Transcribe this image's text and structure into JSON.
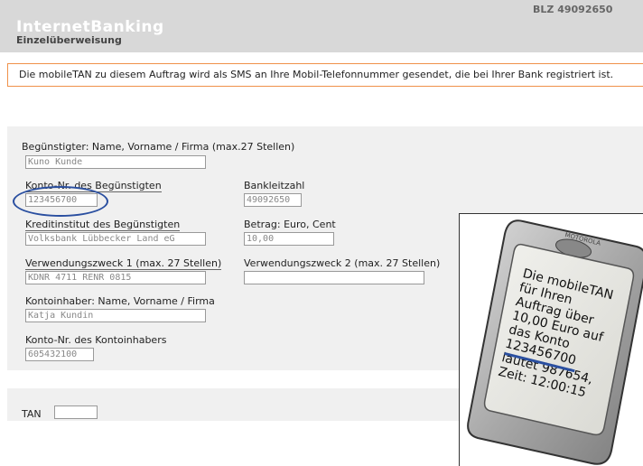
{
  "header": {
    "title": "InternetBanking",
    "subtitle": "Einzelüberweisung",
    "blz": "BLZ 49092650"
  },
  "notice": "Die mobileTAN zu diesem Auftrag wird als SMS an Ihre Mobil-Telefonnummer gesendet, die bei Ihrer Bank registriert ist.",
  "form": {
    "beneficiary_label": "Begünstigter: Name, Vorname / Firma (max.27 Stellen)",
    "beneficiary_value": "Kuno Kunde",
    "account_label": "Konto-Nr. des Begünstigten",
    "account_value": "123456700",
    "blz_label": "Bankleitzahl",
    "blz_value": "49092650",
    "bank_label": "Kreditinstitut des Begünstigten",
    "bank_value": "Volksbank Lübbecker  Land eG",
    "amount_label": "Betrag: Euro, Cent",
    "amount_value": "10,00",
    "purpose1_label": "Verwendungszweck 1 (max. 27 Stellen)",
    "purpose1_value": "KDNR 4711 RENR 0815",
    "purpose2_label": "Verwendungszweck 2 (max. 27 Stellen)",
    "purpose2_value": "",
    "holder_label": "Kontoinhaber: Name, Vorname / Firma",
    "holder_value": "Katja Kundin",
    "holder_account_label": "Konto-Nr. des Kontoinhabers",
    "holder_account_value": "605432100",
    "tan_label": "TAN",
    "tan_value": ""
  },
  "phone": {
    "brand": "MOTOROLA",
    "sms_lines": [
      "Die mobileTAN",
      "für Ihren",
      "Auftrag über",
      "10,00 Euro auf",
      "das Konto",
      "123456700",
      "lautet 987654,",
      "Zeit: 12:00:15"
    ]
  },
  "colors": {
    "header_bg": "#d8d8d8",
    "notice_border": "#f0914a",
    "form_bg": "#f0f0f0",
    "highlight": "#2a4fa0"
  }
}
